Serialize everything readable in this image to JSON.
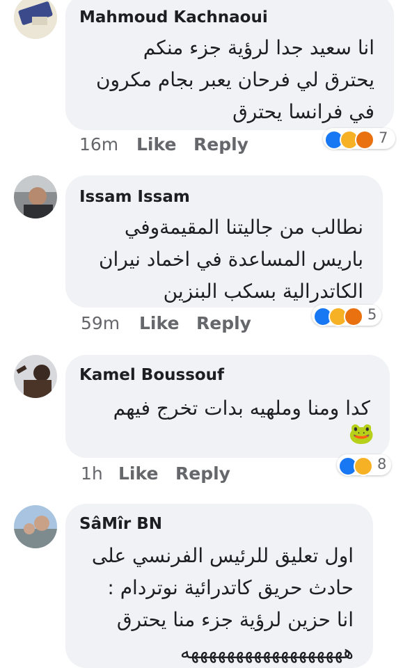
{
  "comments": [
    {
      "author": "Mahmoud Kachnaoui",
      "text": "انا سعيد جدا لرؤية جزء منكم\nيحترق لي فرحان يعبر بجام مكرون\nفي فرانسا يحترق",
      "time": "16m",
      "like": "Like",
      "reply": "Reply",
      "reactions": [
        "like-icon",
        "haha-icon",
        "angry-icon"
      ],
      "count": "7"
    },
    {
      "author": "Issam Issam",
      "text": "نطالب من جاليتنا المقيمةوفي\nباريس المساعدة في اخماد نيران\nالكاتدرالية بسكب البنزين",
      "time": "59m",
      "like": "Like",
      "reply": "Reply",
      "reactions": [
        "like-icon",
        "haha-icon",
        "angry-icon"
      ],
      "count": "5"
    },
    {
      "author": "Kamel Boussouf",
      "text": "كدا ومنا وملهيه بدات تخرج فيهم",
      "emoji": "🐸",
      "time": "1h",
      "like": "Like",
      "reply": "Reply",
      "reactions": [
        "like-icon",
        "haha-icon"
      ],
      "count": "8"
    },
    {
      "author": "SâMîr BN",
      "text": "اول تعليق للرئيس الفرنسي على\nحادث حريق كاتدرائية نوتردام :\nانا حزين لرؤية جزء منا يحترق\nههههههههههههههههههه"
    }
  ],
  "colors": {
    "bubble": "#f0f2f5",
    "meta": "#65676b",
    "like": "#1877f2",
    "haha": "#f7b125",
    "angry": "#e9710f"
  }
}
